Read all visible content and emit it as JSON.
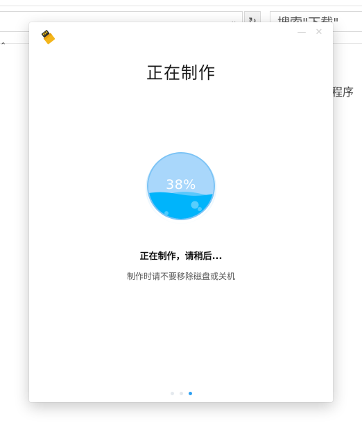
{
  "background": {
    "search_placeholder": "搜索\"下载\"",
    "partial_text": "程序",
    "dropdown_icon": "chevron-down-icon",
    "refresh_icon": "refresh-icon"
  },
  "dialog": {
    "title": "正在制作",
    "app_icon": "usb-drive-icon",
    "progress": {
      "percent_label": "38%",
      "value": 0.38,
      "color_light": "#a9d7fb",
      "color_fill": "#00b4fb",
      "color_ring": "#7cc3f5"
    },
    "status": "正在制作，请稍后...",
    "hint": "制作时请不要移除磁盘或关机",
    "pager": {
      "count": 3,
      "active_index": 2,
      "active_color": "#2ea0f2"
    }
  }
}
